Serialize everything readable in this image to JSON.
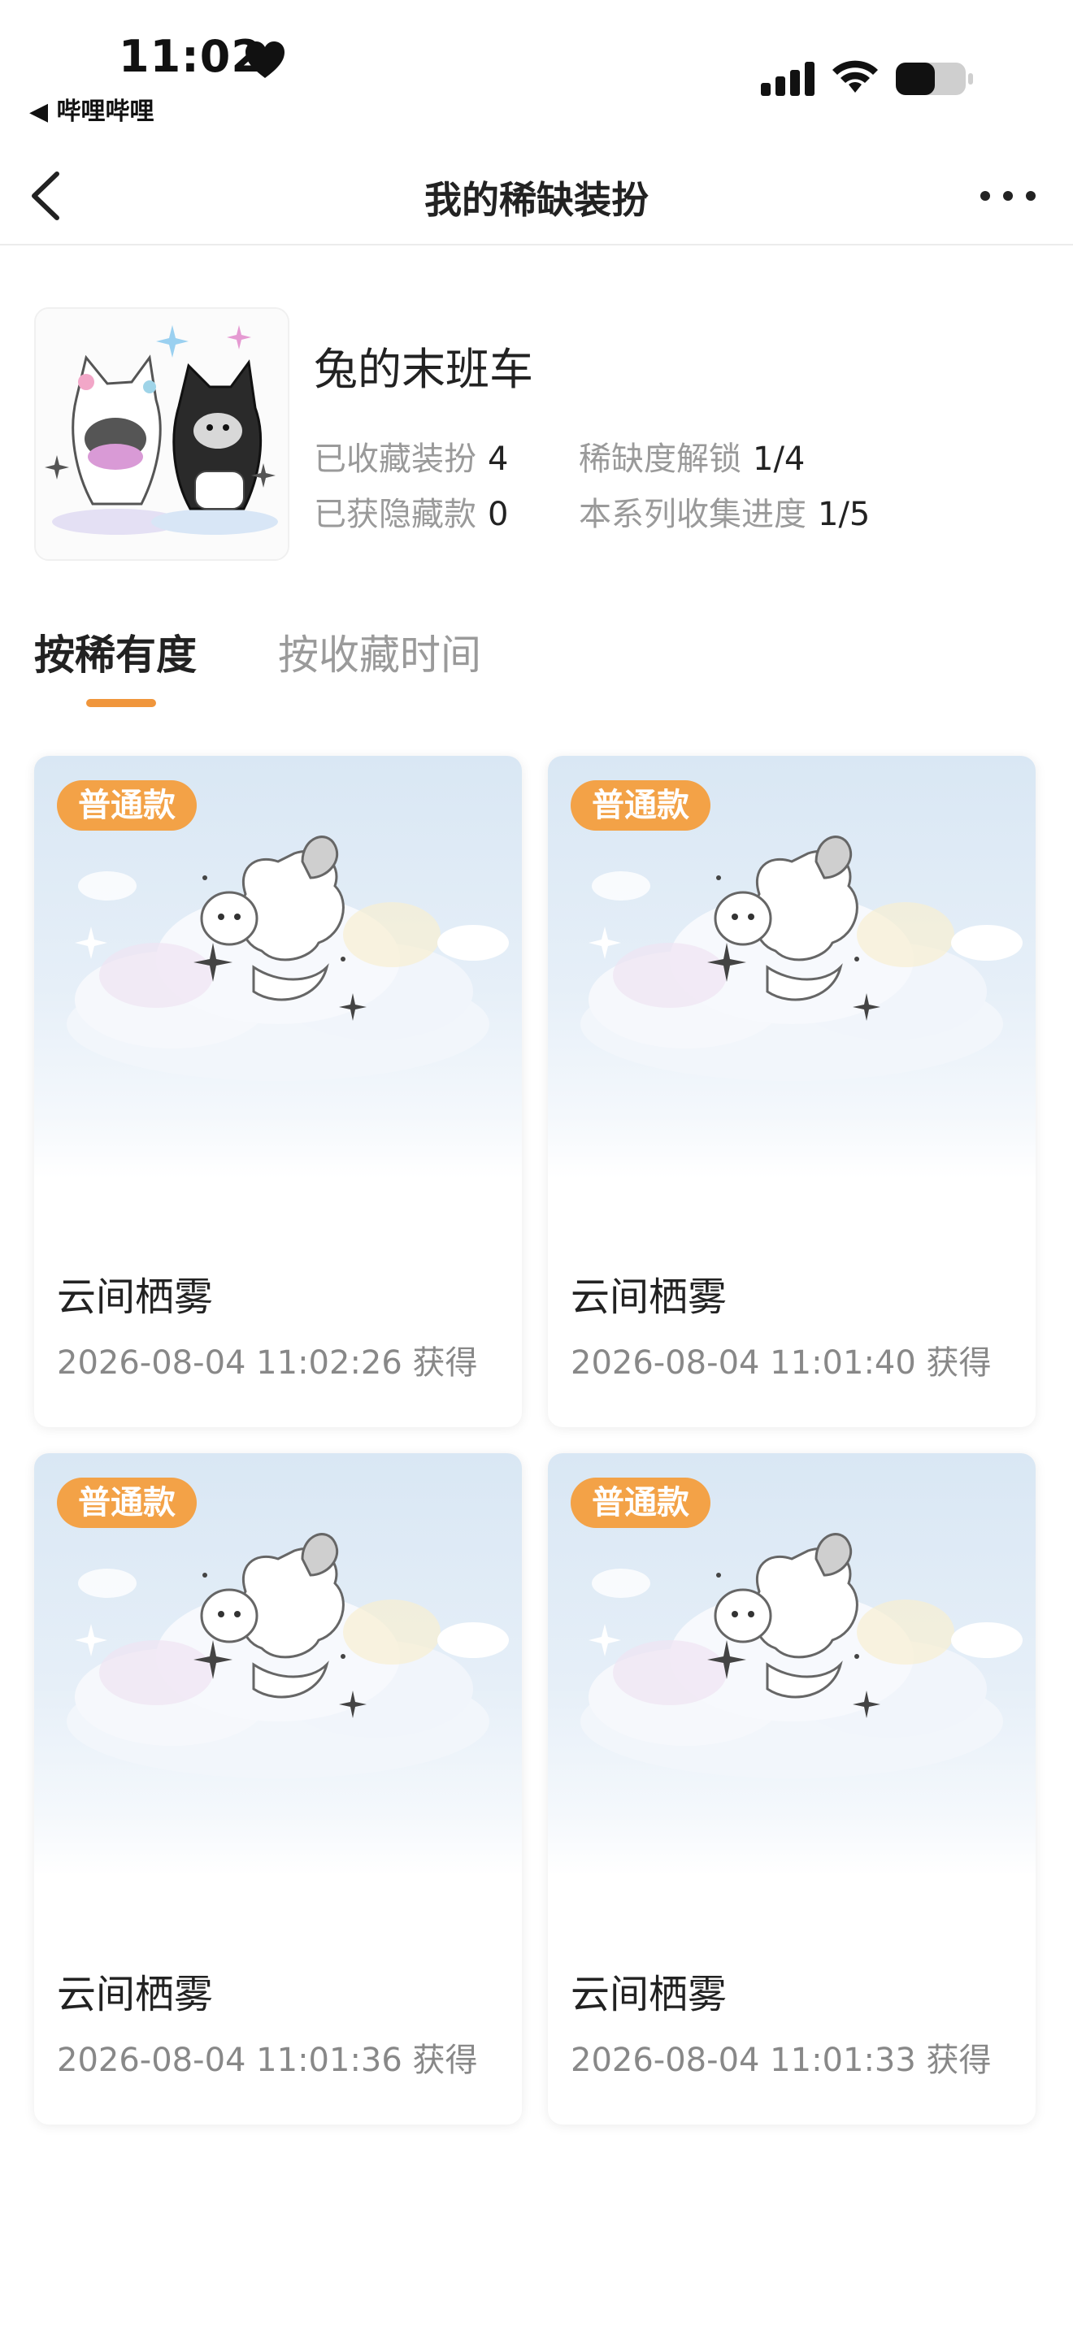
{
  "status_bar": {
    "time": "11:02",
    "back_app": "◀ 哔哩哔哩"
  },
  "nav": {
    "title": "我的稀缺装扮"
  },
  "series": {
    "name": "兔的末班车",
    "stats": [
      {
        "label": "已收藏装扮",
        "value": "4"
      },
      {
        "label": "稀缺度解锁",
        "value": "1/4"
      },
      {
        "label": "已获隐藏款",
        "value": "0"
      },
      {
        "label": "本系列收集进度",
        "value": "1/5"
      }
    ]
  },
  "tabs": [
    {
      "label": "按稀有度",
      "active": true
    },
    {
      "label": "按收藏时间",
      "active": false
    }
  ],
  "cards": [
    {
      "badge": "普通款",
      "title": "云间栖雾",
      "time": "2026-08-04 11:02:26 获得"
    },
    {
      "badge": "普通款",
      "title": "云间栖雾",
      "time": "2026-08-04 11:01:40 获得"
    },
    {
      "badge": "普通款",
      "title": "云间栖雾",
      "time": "2026-08-04 11:01:36 获得"
    },
    {
      "badge": "普通款",
      "title": "云间栖雾",
      "time": "2026-08-04 11:01:33 获得"
    }
  ],
  "colors": {
    "accent": "#f0963c",
    "badge": "#f3a247"
  }
}
